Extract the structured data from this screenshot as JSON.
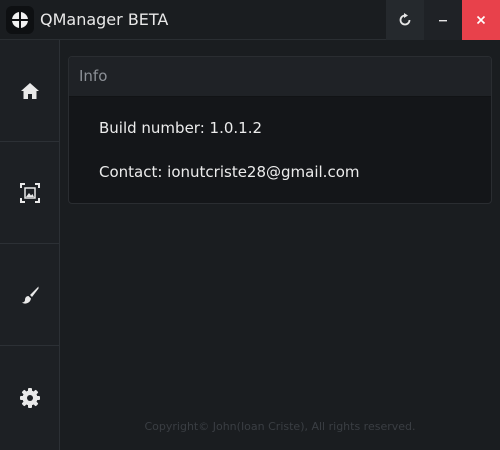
{
  "app": {
    "title": "QManager BETA",
    "logo_icon": "crosshair-logo-icon"
  },
  "window_controls": {
    "refresh_icon": "refresh-icon",
    "minimize_icon": "minimize-icon",
    "close_icon": "close-icon",
    "close_color": "#e8414b"
  },
  "sidebar": {
    "items": [
      {
        "name": "home",
        "icon": "home-icon"
      },
      {
        "name": "images",
        "icon": "image-select-icon"
      },
      {
        "name": "edit",
        "icon": "brush-icon"
      },
      {
        "name": "settings",
        "icon": "gear-icon"
      }
    ]
  },
  "info_card": {
    "header": "Info",
    "build_label": "Build number: 1.0.1.2",
    "contact_label": "Contact: ionutcriste28@gmail.com"
  },
  "footer": {
    "copyright": "Copyright© John(Ioan Criste), All rights reserved."
  }
}
